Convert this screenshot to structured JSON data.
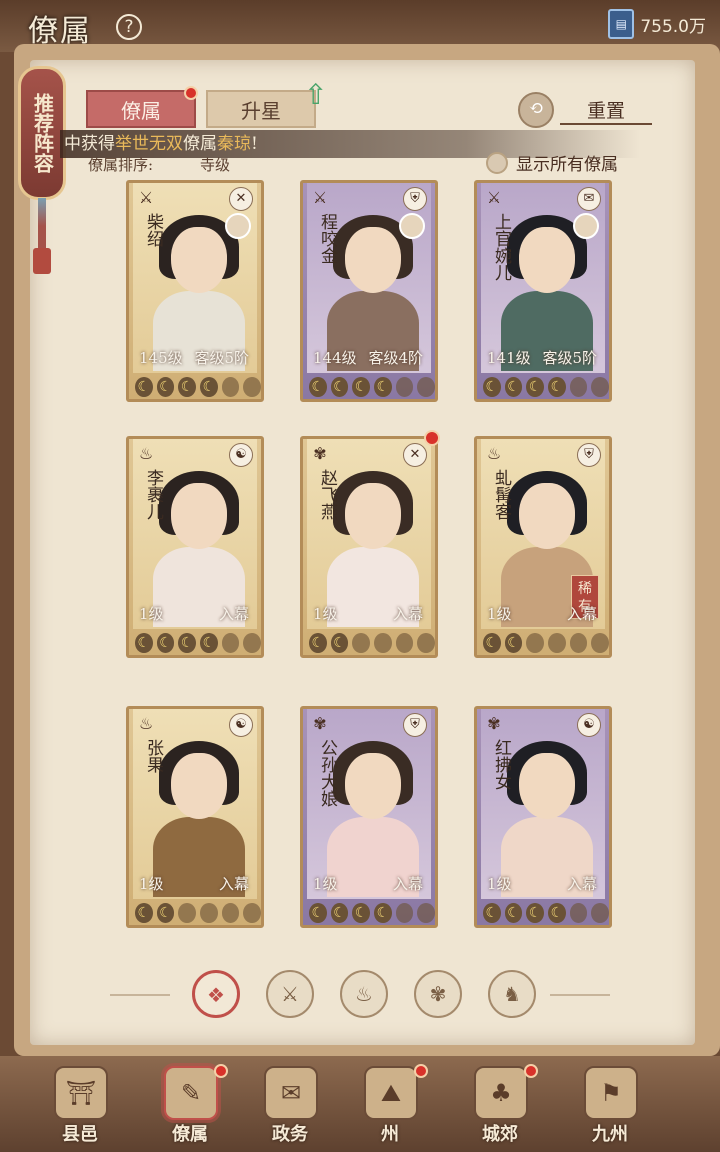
{
  "header": {
    "title": "僚属",
    "help": "?",
    "currency_value": "755.0万",
    "currency_icon": "ticket-icon"
  },
  "recommend": {
    "label": "推荐阵容"
  },
  "tabs": [
    {
      "label": "僚属"
    },
    {
      "label": "升星"
    }
  ],
  "reset": {
    "label": "重置"
  },
  "notice": {
    "prefix": "中获得",
    "rarity": "举世无双",
    "mid": "僚属",
    "name": "秦琼",
    "suffix": "!"
  },
  "sort": {
    "label": "僚属排序:",
    "value": "寺级"
  },
  "show_all": {
    "label": "显示所有僚属"
  },
  "cards": [
    {
      "name": "柴绍",
      "level": "145级",
      "rank": "客级5阶",
      "tier": "gold",
      "class_icon": "warrior-icon",
      "type_icon": "sword-icon",
      "moons": 4
    },
    {
      "name": "程咬金",
      "level": "144级",
      "rank": "客级4阶",
      "tier": "purple",
      "class_icon": "warrior-icon",
      "type_icon": "shield-icon",
      "moons": 4
    },
    {
      "name": "上官婉儿",
      "level": "141级",
      "rank": "客级5阶",
      "tier": "purple",
      "class_icon": "warrior-icon",
      "type_icon": "scroll-icon",
      "moons": 4
    },
    {
      "name": "李裹儿",
      "level": "1级",
      "rank": "入幕",
      "tier": "gold",
      "class_icon": "gourd-icon",
      "type_icon": "yinyang-icon",
      "moons": 4
    },
    {
      "name": "赵飞燕",
      "level": "1级",
      "rank": "入幕",
      "tier": "gold",
      "class_icon": "fan-icon",
      "type_icon": "sword-icon",
      "moons": 2
    },
    {
      "name": "虬髯客",
      "level": "1级",
      "rank": "入幕",
      "tier": "gold",
      "class_icon": "gourd-icon",
      "type_icon": "shield-icon",
      "moons": 2,
      "rare": "稀有"
    },
    {
      "name": "张果",
      "level": "1级",
      "rank": "入幕",
      "tier": "gold",
      "class_icon": "gourd-icon",
      "type_icon": "yinyang-icon",
      "moons": 2
    },
    {
      "name": "公孙大娘",
      "level": "1级",
      "rank": "入幕",
      "tier": "purple",
      "class_icon": "fan-icon",
      "type_icon": "shield-icon",
      "moons": 4
    },
    {
      "name": "红拂女",
      "level": "1级",
      "rank": "入幕",
      "tier": "purple",
      "class_icon": "fan-icon",
      "type_icon": "yinyang-icon",
      "moons": 4
    }
  ],
  "filters": [
    {
      "icon": "all-icon",
      "glyph": "❖"
    },
    {
      "icon": "warrior-icon",
      "glyph": "⚔"
    },
    {
      "icon": "gourd-icon",
      "glyph": "♨"
    },
    {
      "icon": "fan-icon",
      "glyph": "✾"
    },
    {
      "icon": "beast-icon",
      "glyph": "♞"
    }
  ],
  "nav": [
    {
      "label": "县邑",
      "glyph": "⛩"
    },
    {
      "label": "僚属",
      "glyph": "✎"
    },
    {
      "label": "政务",
      "glyph": "✉"
    },
    {
      "label": "州",
      "glyph": "⛰"
    },
    {
      "label": "城郊",
      "glyph": "♣"
    },
    {
      "label": "九州",
      "glyph": "⚑"
    }
  ]
}
